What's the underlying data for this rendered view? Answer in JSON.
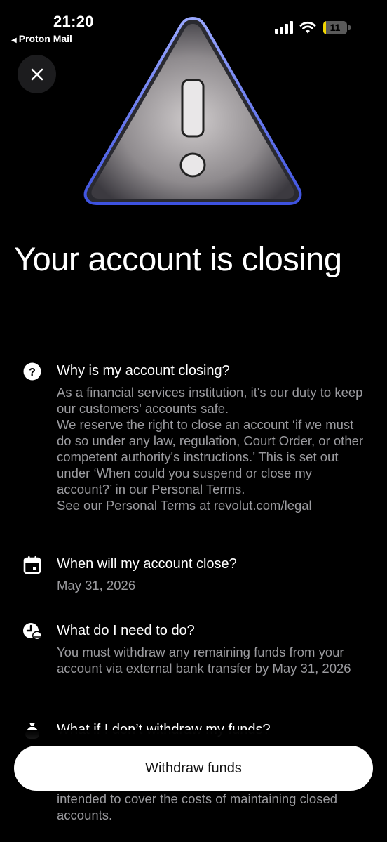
{
  "status_bar": {
    "time": "21:20",
    "back_app": "Proton Mail",
    "battery_level": "11",
    "battery_color": "#f2d600"
  },
  "close_icon": "close-icon",
  "warning_icon": "warning-triangle-icon",
  "page_title": "Your account is closing",
  "sections": [
    {
      "icon": "question-circle-icon",
      "heading": "Why is my account closing?",
      "body": "As a financial services institution, it's our duty to keep our customers' accounts safe.\nWe reserve the right to close an account ‘if we must do so under any law, regulation, Court Order, or other competent authority's instructions.’ This is set out under ‘When could you suspend or close my account?’ in our Personal Terms.\nSee our Personal Terms at revolut.com/legal"
    },
    {
      "icon": "calendar-icon",
      "heading": "When will my account close?",
      "body": "May 31, 2026"
    },
    {
      "icon": "clock-coins-icon",
      "heading": "What do I need to do?",
      "body": "You must withdraw any remaining funds from your account via external bank transfer by May 31, 2026"
    },
    {
      "icon": "money-bag-icon",
      "heading": "What if I don’t withdraw my funds?",
      "body": ""
    }
  ],
  "withdraw_button": "Withdraw funds",
  "scrolled_text": "intended to cover the costs of maintaining closed accounts."
}
